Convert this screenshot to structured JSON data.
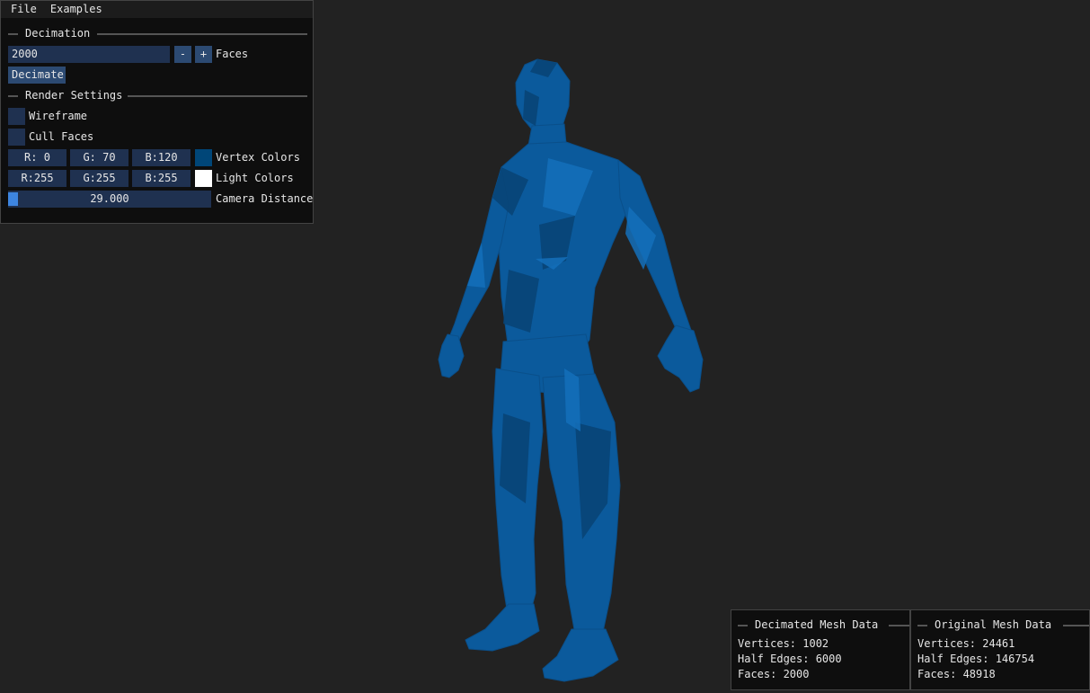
{
  "menu": {
    "file": "File",
    "examples": "Examples"
  },
  "decimation": {
    "header": "Decimation",
    "faces_value": "2000",
    "minus": "-",
    "plus": "+",
    "faces_label": "Faces",
    "decimate_button": "Decimate"
  },
  "render_settings": {
    "header": "Render Settings",
    "wireframe_label": "Wireframe",
    "wireframe_checked": false,
    "cull_faces_label": "Cull Faces",
    "cull_faces_checked": false,
    "vertex_colors": {
      "r": "R:  0",
      "g": "G: 70",
      "b": "B:120",
      "label": "Vertex Colors",
      "swatch": "#004678"
    },
    "light_colors": {
      "r": "R:255",
      "g": "G:255",
      "b": "B:255",
      "label": "Light Colors",
      "swatch": "#ffffff"
    },
    "camera_distance": {
      "value": "29.000",
      "label": "Camera Distance"
    }
  },
  "decimated_mesh": {
    "header": "Decimated Mesh Data",
    "vertices": "Vertices: 1002",
    "half_edges": "Half Edges: 6000",
    "faces": "Faces: 2000"
  },
  "original_mesh": {
    "header": "Original Mesh Data",
    "vertices": "Vertices: 24461",
    "half_edges": "Half Edges: 146754",
    "faces": "Faces: 48918"
  },
  "colors": {
    "background": "#222222",
    "mesh": "#0b5a9c",
    "accent": "#2c4a72"
  }
}
